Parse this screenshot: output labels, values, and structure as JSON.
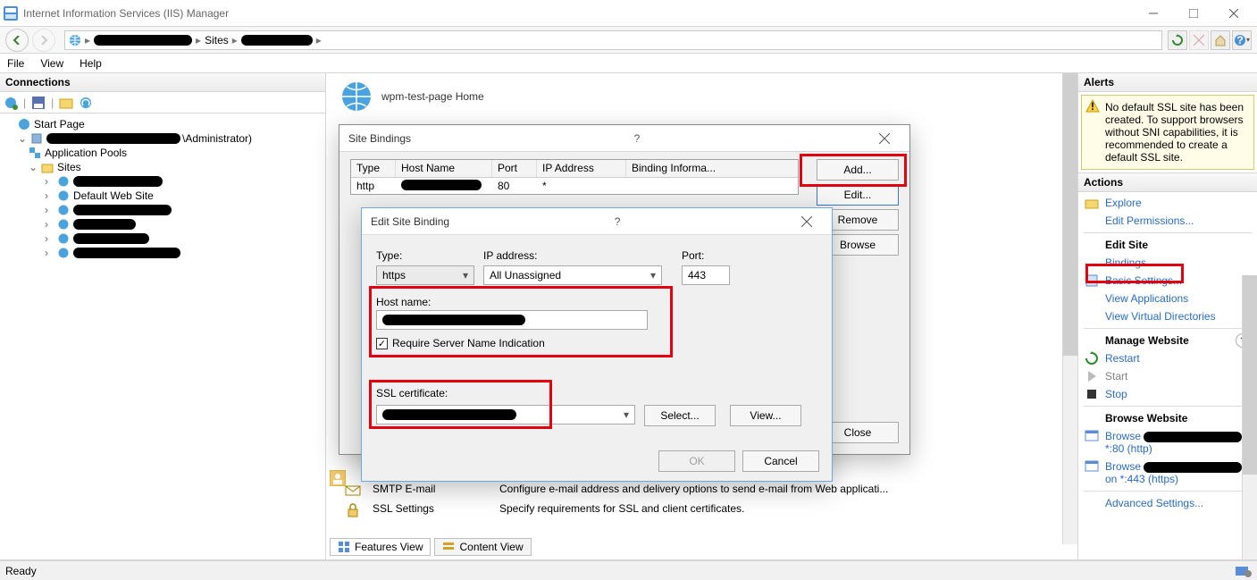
{
  "window": {
    "title": "Internet Information Services (IIS) Manager"
  },
  "breadcrumb": {
    "segments": [
      "",
      "Sites",
      ""
    ]
  },
  "menu": {
    "file": "File",
    "view": "View",
    "help": "Help"
  },
  "left": {
    "title": "Connections",
    "start_page": "Start Page",
    "server_suffix": "\\Administrator)",
    "app_pools": "Application Pools",
    "sites": "Sites",
    "default_site": "Default Web Site"
  },
  "center": {
    "title": "wpm-test-page Home",
    "rows": [
      {
        "name": "SMTP E-mail",
        "desc": "Configure e-mail address and delivery options to send e-mail from Web applicati..."
      },
      {
        "name": "SSL Settings",
        "desc": "Specify requirements for SSL and client certificates."
      }
    ],
    "tabs": {
      "features": "Features View",
      "content": "Content View"
    }
  },
  "site_bindings": {
    "title": "Site Bindings",
    "cols": {
      "type": "Type",
      "host": "Host Name",
      "port": "Port",
      "ip": "IP Address",
      "info": "Binding Informa..."
    },
    "row": {
      "type": "http",
      "port": "80",
      "ip": "*"
    },
    "btns": {
      "add": "Add...",
      "edit": "Edit...",
      "remove": "Remove",
      "browse": "Browse",
      "close": "Close"
    }
  },
  "edit_binding": {
    "title": "Edit Site Binding",
    "labels": {
      "type": "Type:",
      "ip": "IP address:",
      "port": "Port:",
      "host": "Host name:",
      "sni": "Require Server Name Indication",
      "ssl": "SSL certificate:"
    },
    "values": {
      "type": "https",
      "ip": "All Unassigned",
      "port": "443"
    },
    "btns": {
      "select": "Select...",
      "view": "View...",
      "ok": "OK",
      "cancel": "Cancel"
    }
  },
  "alerts": {
    "title": "Alerts",
    "msg": "No default SSL site has been created. To support browsers without SNI capabilities, it is recommended to create a default SSL site."
  },
  "actions": {
    "title": "Actions",
    "explore": "Explore",
    "edit_perm": "Edit Permissions...",
    "edit_site": "Edit Site",
    "bindings": "Bindings...",
    "basic": "Basic Settings...",
    "view_apps": "View Applications",
    "view_dirs": "View Virtual Directories",
    "manage": "Manage Website",
    "restart": "Restart",
    "start": "Start",
    "stop": "Stop",
    "browse_web": "Browse Website",
    "browse1": "Browse",
    "browse1_sub": "*:80 (http)",
    "browse2": "Browse",
    "browse2_sub": "on *:443 (https)",
    "advanced": "Advanced Settings..."
  },
  "status": {
    "text": "Ready"
  }
}
